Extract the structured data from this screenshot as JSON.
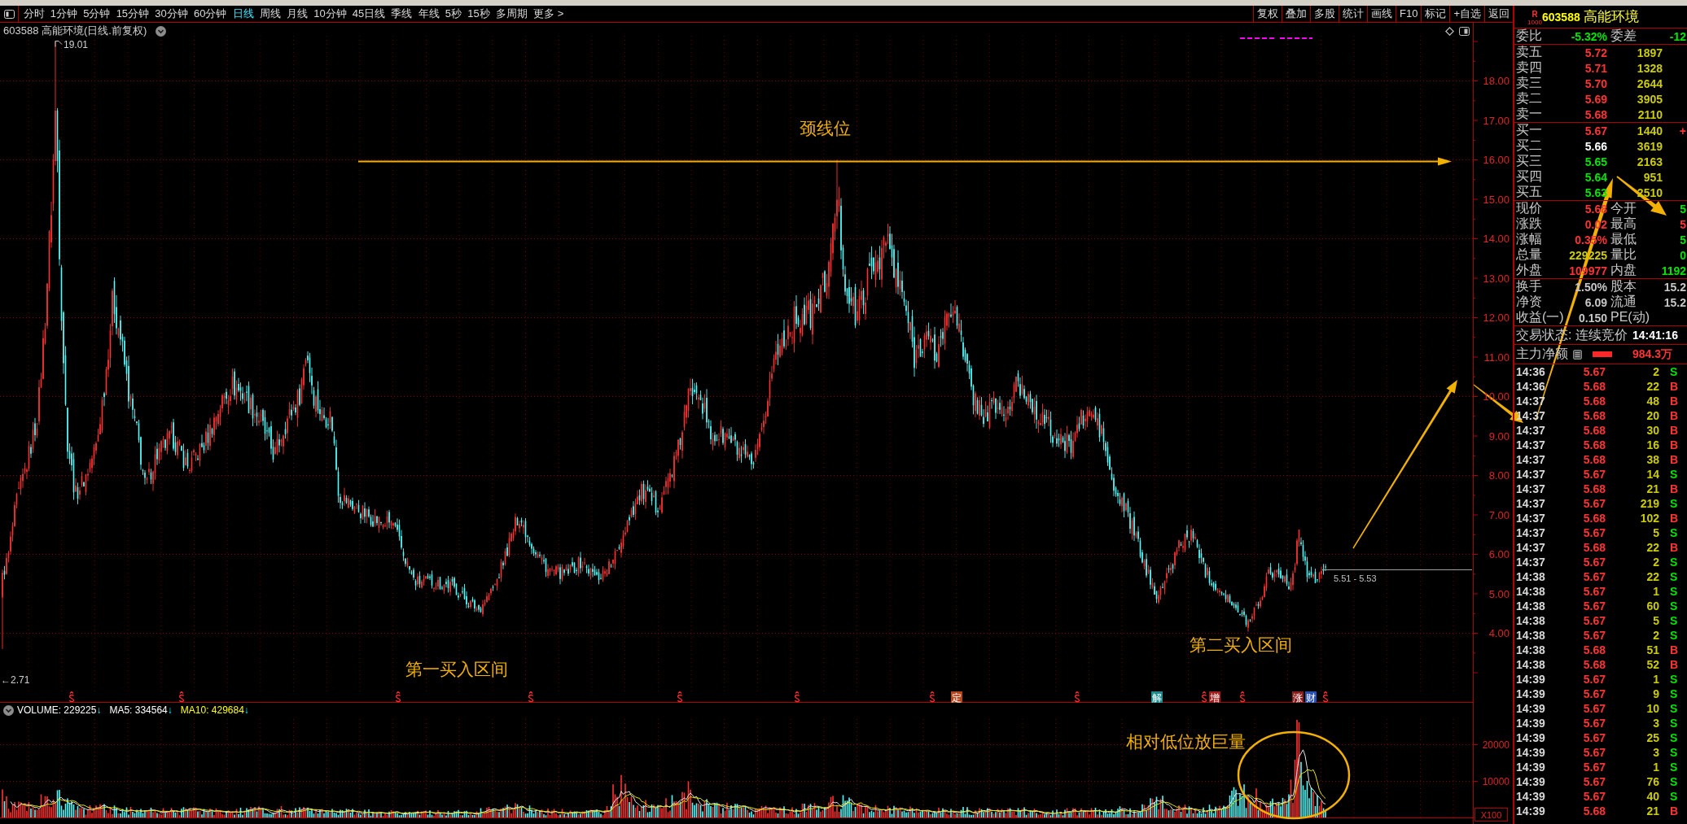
{
  "toolbar": {
    "periods": [
      {
        "label": "分时",
        "selected": false
      },
      {
        "label": "1分钟",
        "selected": false
      },
      {
        "label": "5分钟",
        "selected": false
      },
      {
        "label": "15分钟",
        "selected": false
      },
      {
        "label": "30分钟",
        "selected": false
      },
      {
        "label": "60分钟",
        "selected": false
      },
      {
        "label": "日线",
        "selected": true
      },
      {
        "label": "周线",
        "selected": false
      },
      {
        "label": "月线",
        "selected": false
      },
      {
        "label": "10分钟",
        "selected": false
      },
      {
        "label": "45日线",
        "selected": false
      },
      {
        "label": "季线",
        "selected": false
      },
      {
        "label": "年线",
        "selected": false
      },
      {
        "label": "5秒",
        "selected": false
      },
      {
        "label": "15秒",
        "selected": false
      },
      {
        "label": "多周期",
        "selected": false
      },
      {
        "label": "更多 >",
        "selected": false
      }
    ],
    "tools": [
      "复权",
      "叠加",
      "多股",
      "统计",
      "画线",
      "F10",
      "标记",
      "+自选",
      "返回"
    ]
  },
  "chart": {
    "title": "603588 高能环境(日线.前复权)",
    "high_label": "19.01",
    "low_label": "←2.71",
    "price_axis": [
      "18.00",
      "17.00",
      "16.00",
      "15.00",
      "14.00",
      "13.00",
      "12.00",
      "11.00",
      "10.00",
      "9.00",
      "8.00",
      "7.00",
      "6.00",
      "5.00",
      "4.00"
    ],
    "range_label": "5.51 - 5.53",
    "event_labels": [
      {
        "text": "定",
        "color": "#b4461e"
      },
      {
        "text": "解",
        "color": "#1e8c8c"
      },
      {
        "text": "增",
        "color": "#a01e1e"
      },
      {
        "text": "涨",
        "color": "#8c1e1e"
      },
      {
        "text": "财",
        "color": "#2850b4"
      }
    ]
  },
  "volume": {
    "legend": [
      {
        "text": "VOLUME: 229225",
        "arrow": "↓",
        "color": "#ffffff"
      },
      {
        "text": "MA5: 334564",
        "arrow": "↓",
        "color": "#ffffff"
      },
      {
        "text": "MA10: 429684",
        "arrow": "↓",
        "color": "#ffff00"
      }
    ],
    "axis": [
      "20000",
      "10000"
    ],
    "unit": "X100"
  },
  "annotations": {
    "neckline": "颈线位",
    "first_zone": "第一买入区间",
    "second_zone": "第二买入区间",
    "volume_note": "相对低位放巨量"
  },
  "quote": {
    "badge_letter": "R",
    "badge_number": "1000",
    "code": "603588",
    "name": "高能环境",
    "ratio": {
      "cells": [
        {
          "label": "委比",
          "value": "-5.32%"
        },
        {
          "label": "委差",
          "value": "-12"
        }
      ]
    },
    "asks": [
      {
        "label": "卖五",
        "price": "5.72",
        "volume": "1897",
        "color": "#ff3333"
      },
      {
        "label": "卖四",
        "price": "5.71",
        "volume": "1328",
        "color": "#ff3333"
      },
      {
        "label": "卖三",
        "price": "5.70",
        "volume": "2644",
        "color": "#ff3333"
      },
      {
        "label": "卖二",
        "price": "5.69",
        "volume": "3905",
        "color": "#ff3333"
      },
      {
        "label": "卖一",
        "price": "5.68",
        "volume": "2110",
        "color": "#ff3333"
      }
    ],
    "bids": [
      {
        "label": "买一",
        "price": "5.67",
        "volume": "1440",
        "color": "#ff3333",
        "change": "+"
      },
      {
        "label": "买二",
        "price": "5.66",
        "volume": "3619",
        "color": "#ffffff"
      },
      {
        "label": "买三",
        "price": "5.65",
        "volume": "2163",
        "color": "#00e600"
      },
      {
        "label": "买四",
        "price": "5.64",
        "volume": "951",
        "color": "#00e600"
      },
      {
        "label": "买五",
        "price": "5.63",
        "volume": "2510",
        "color": "#00e600"
      }
    ],
    "stats": [
      {
        "cells": [
          {
            "label": "现价",
            "value": "5.68",
            "color": "#ff3333"
          },
          {
            "label": "今开",
            "value": "5",
            "color": "#00e600"
          }
        ]
      },
      {
        "cells": [
          {
            "label": "涨跌",
            "value": "0.02",
            "color": "#ff3333"
          },
          {
            "label": "最高",
            "value": "5",
            "color": "#ff3333"
          }
        ]
      },
      {
        "cells": [
          {
            "label": "涨幅",
            "value": "0.35%",
            "color": "#ff3333"
          },
          {
            "label": "最低",
            "value": "5",
            "color": "#00e600"
          }
        ]
      },
      {
        "cells": [
          {
            "label": "总量",
            "value": "229225",
            "color": "#cccc00"
          },
          {
            "label": "量比",
            "value": "0",
            "color": "#00e600"
          }
        ]
      },
      {
        "cells": [
          {
            "label": "外盘",
            "value": "109977",
            "color": "#ff3333"
          },
          {
            "label": "内盘",
            "value": "1192",
            "color": "#00e600"
          }
        ]
      }
    ],
    "info": [
      {
        "cells": [
          {
            "label": "换手",
            "value": "1.50%"
          },
          {
            "label": "股本",
            "value": "15.2"
          }
        ]
      },
      {
        "cells": [
          {
            "label": "净资",
            "value": "6.09"
          },
          {
            "label": "流通",
            "value": "15.2"
          }
        ]
      },
      {
        "cells": [
          {
            "label": "收益(一)",
            "value": "0.150"
          },
          {
            "label": "PE(动)"
          }
        ]
      }
    ],
    "status": {
      "label": "交易状态: 连续竞价",
      "time": "14:41:16"
    },
    "net_flow": {
      "label": "主力净额",
      "value": "984.3万"
    },
    "ticks": [
      {
        "time": "14:36",
        "price": "5.67",
        "volume": "2",
        "flag": "S",
        "buy": false
      },
      {
        "time": "14:36",
        "price": "5.68",
        "volume": "22",
        "flag": "B",
        "buy": true
      },
      {
        "time": "14:37",
        "price": "5.68",
        "volume": "48",
        "flag": "B",
        "buy": true
      },
      {
        "time": "14:37",
        "price": "5.68",
        "volume": "20",
        "flag": "B",
        "buy": true
      },
      {
        "time": "14:37",
        "price": "5.68",
        "volume": "30",
        "flag": "B",
        "buy": true
      },
      {
        "time": "14:37",
        "price": "5.68",
        "volume": "16",
        "flag": "B",
        "buy": true
      },
      {
        "time": "14:37",
        "price": "5.68",
        "volume": "38",
        "flag": "B",
        "buy": true
      },
      {
        "time": "14:37",
        "price": "5.67",
        "volume": "14",
        "flag": "S",
        "buy": false
      },
      {
        "time": "14:37",
        "price": "5.68",
        "volume": "21",
        "flag": "B",
        "buy": true
      },
      {
        "time": "14:37",
        "price": "5.67",
        "volume": "219",
        "flag": "S",
        "buy": false
      },
      {
        "time": "14:37",
        "price": "5.68",
        "volume": "102",
        "flag": "B",
        "buy": true
      },
      {
        "time": "14:37",
        "price": "5.67",
        "volume": "5",
        "flag": "S",
        "buy": false
      },
      {
        "time": "14:37",
        "price": "5.68",
        "volume": "22",
        "flag": "B",
        "buy": true
      },
      {
        "time": "14:37",
        "price": "5.67",
        "volume": "2",
        "flag": "S",
        "buy": false
      },
      {
        "time": "14:38",
        "price": "5.67",
        "volume": "22",
        "flag": "S",
        "buy": false
      },
      {
        "time": "14:38",
        "price": "5.67",
        "volume": "1",
        "flag": "S",
        "buy": false
      },
      {
        "time": "14:38",
        "price": "5.67",
        "volume": "60",
        "flag": "S",
        "buy": false
      },
      {
        "time": "14:38",
        "price": "5.67",
        "volume": "5",
        "flag": "S",
        "buy": false
      },
      {
        "time": "14:38",
        "price": "5.67",
        "volume": "2",
        "flag": "S",
        "buy": false
      },
      {
        "time": "14:38",
        "price": "5.68",
        "volume": "51",
        "flag": "B",
        "buy": true
      },
      {
        "time": "14:38",
        "price": "5.68",
        "volume": "52",
        "flag": "B",
        "buy": true
      },
      {
        "time": "14:39",
        "price": "5.67",
        "volume": "1",
        "flag": "S",
        "buy": false
      },
      {
        "time": "14:39",
        "price": "5.67",
        "volume": "9",
        "flag": "S",
        "buy": false
      },
      {
        "time": "14:39",
        "price": "5.67",
        "volume": "10",
        "flag": "S",
        "buy": false
      },
      {
        "time": "14:39",
        "price": "5.67",
        "volume": "3",
        "flag": "S",
        "buy": false
      },
      {
        "time": "14:39",
        "price": "5.67",
        "volume": "25",
        "flag": "S",
        "buy": false
      },
      {
        "time": "14:39",
        "price": "5.67",
        "volume": "3",
        "flag": "S",
        "buy": false
      },
      {
        "time": "14:39",
        "price": "5.67",
        "volume": "1",
        "flag": "S",
        "buy": false
      },
      {
        "time": "14:39",
        "price": "5.67",
        "volume": "76",
        "flag": "S",
        "buy": false
      },
      {
        "time": "14:39",
        "price": "5.67",
        "volume": "40",
        "flag": "S",
        "buy": false
      },
      {
        "time": "14:39",
        "price": "5.68",
        "volume": "21",
        "flag": "B",
        "buy": true
      }
    ]
  }
}
